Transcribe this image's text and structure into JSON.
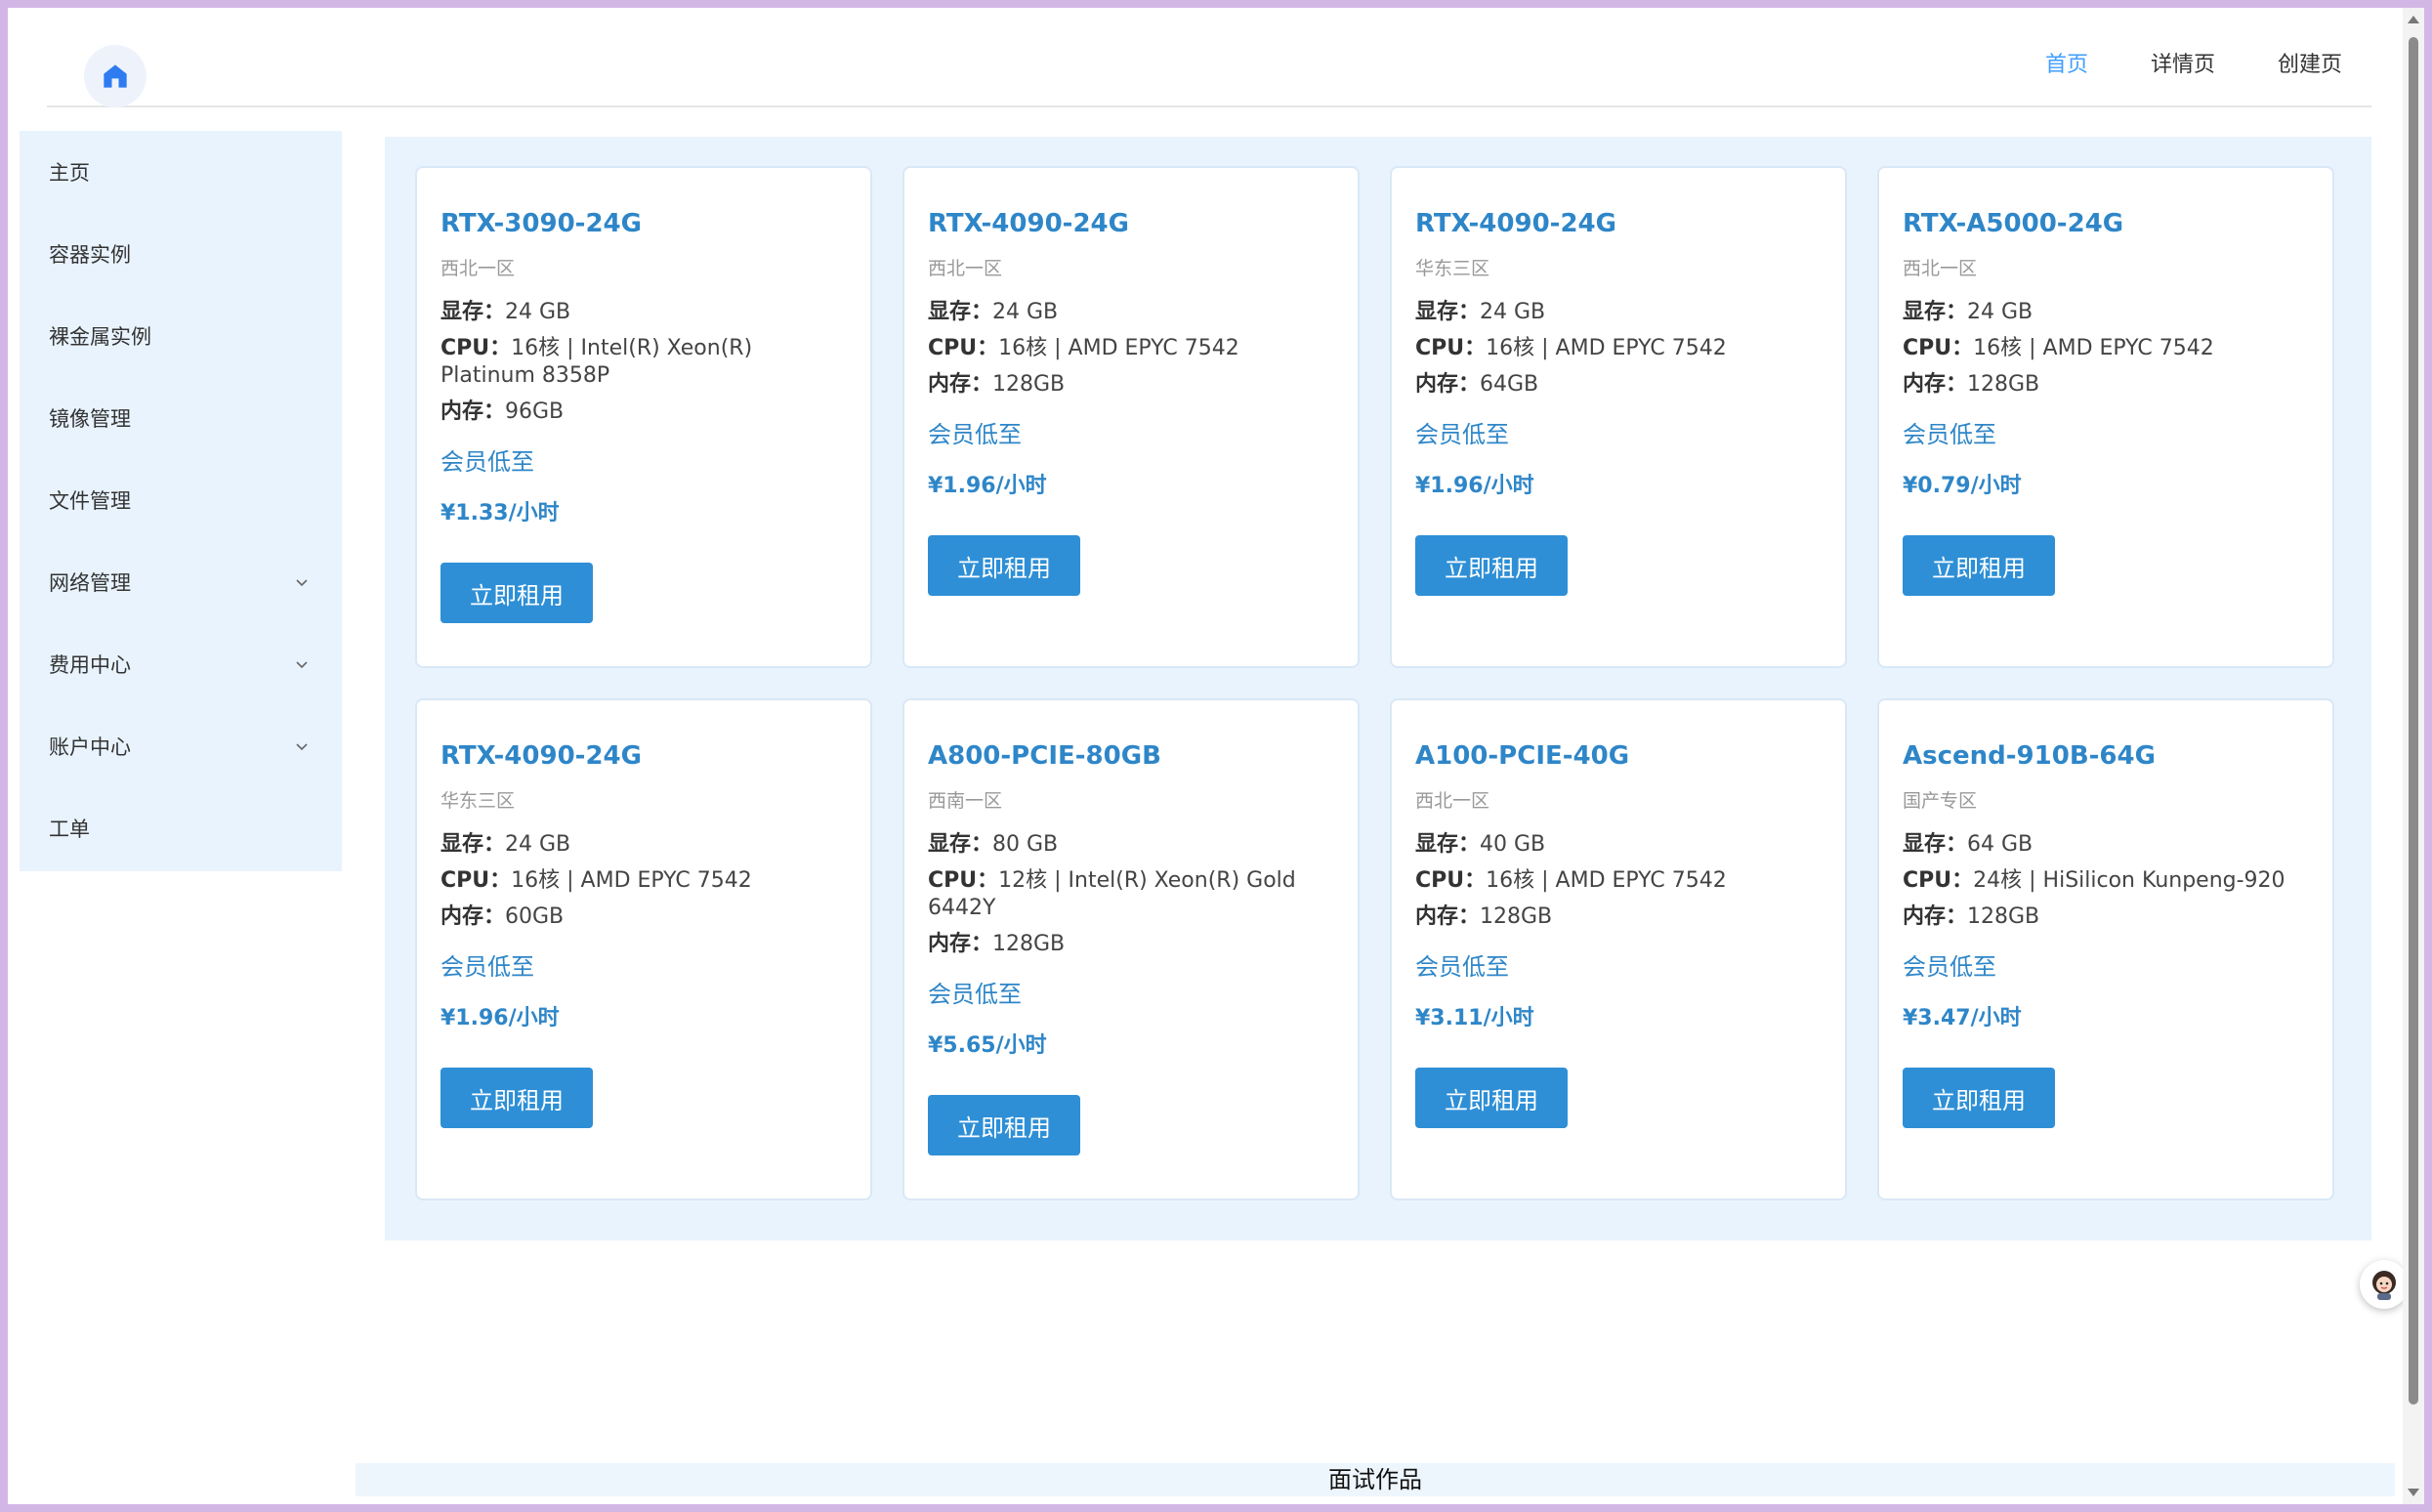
{
  "header": {
    "logo_icon": "home-icon",
    "nav": [
      {
        "label": "首页",
        "active": true
      },
      {
        "label": "详情页",
        "active": false
      },
      {
        "label": "创建页",
        "active": false
      }
    ]
  },
  "sidebar": {
    "items": [
      {
        "label": "主页",
        "has_submenu": false
      },
      {
        "label": "容器实例",
        "has_submenu": false
      },
      {
        "label": "裸金属实例",
        "has_submenu": false
      },
      {
        "label": "镜像管理",
        "has_submenu": false
      },
      {
        "label": "文件管理",
        "has_submenu": false
      },
      {
        "label": "网络管理",
        "has_submenu": true
      },
      {
        "label": "费用中心",
        "has_submenu": true
      },
      {
        "label": "账户中心",
        "has_submenu": true
      },
      {
        "label": "工单",
        "has_submenu": false
      }
    ]
  },
  "labels": {
    "vram": "显存：",
    "cpu": "CPU：",
    "ram": "内存：",
    "member": "会员低至",
    "rent": "立即租用"
  },
  "cards": [
    {
      "name": "RTX-3090-24G",
      "region": "西北一区",
      "vram": "24 GB",
      "cpu": "16核 | Intel(R) Xeon(R) Platinum 8358P",
      "ram": "96GB",
      "price": "¥1.33/小时"
    },
    {
      "name": "RTX-4090-24G",
      "region": "西北一区",
      "vram": "24 GB",
      "cpu": "16核 | AMD EPYC 7542",
      "ram": "128GB",
      "price": "¥1.96/小时"
    },
    {
      "name": "RTX-4090-24G",
      "region": "华东三区",
      "vram": "24 GB",
      "cpu": "16核 | AMD EPYC 7542",
      "ram": "64GB",
      "price": "¥1.96/小时"
    },
    {
      "name": "RTX-A5000-24G",
      "region": "西北一区",
      "vram": "24 GB",
      "cpu": "16核 | AMD EPYC 7542",
      "ram": "128GB",
      "price": "¥0.79/小时"
    },
    {
      "name": "RTX-4090-24G",
      "region": "华东三区",
      "vram": "24 GB",
      "cpu": "16核 | AMD EPYC 7542",
      "ram": "60GB",
      "price": "¥1.96/小时"
    },
    {
      "name": "A800-PCIE-80GB",
      "region": "西南一区",
      "vram": "80 GB",
      "cpu": "12核 | Intel(R) Xeon(R) Gold 6442Y",
      "ram": "128GB",
      "price": "¥5.65/小时"
    },
    {
      "name": "A100-PCIE-40G",
      "region": "西北一区",
      "vram": "40 GB",
      "cpu": "16核 | AMD EPYC 7542",
      "ram": "128GB",
      "price": "¥3.11/小时"
    },
    {
      "name": "Ascend-910B-64G",
      "region": "国产专区",
      "vram": "64 GB",
      "cpu": "24核 | HiSilicon Kunpeng-920",
      "ram": "128GB",
      "price": "¥3.47/小时"
    }
  ],
  "footer": {
    "text": "面试作品"
  },
  "colors": {
    "accent": "#2e86c8",
    "button": "#2e8fd6",
    "panel_bg": "#e8f3fd",
    "active_nav": "#409eff"
  }
}
